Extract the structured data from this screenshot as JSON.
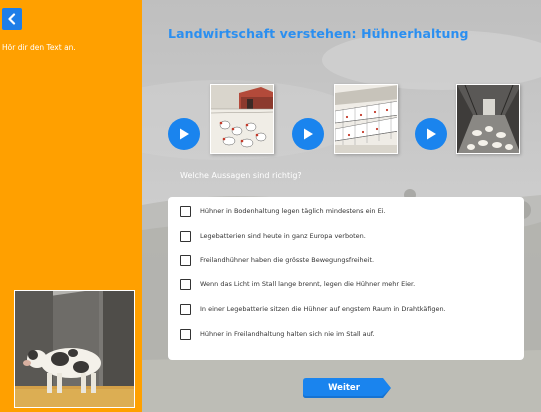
{
  "sidebar": {
    "back_icon": "chevron-left-icon",
    "hint": "Hör dir den Text an."
  },
  "title": "Landwirtschaft verstehen: Hühnerhaltung",
  "media": [
    {
      "play_icon": "play-icon",
      "thumbnail": "free-range-chickens"
    },
    {
      "play_icon": "play-icon",
      "thumbnail": "battery-cages"
    },
    {
      "play_icon": "play-icon",
      "thumbnail": "barn-floor-housing"
    }
  ],
  "question": "Welche Aussagen sind richtig?",
  "answers": [
    {
      "text": "Hühner in Bodenhaltung legen täglich mindestens ein Ei.",
      "checked": false
    },
    {
      "text": "Legebatterien sind heute in ganz Europa verboten.",
      "checked": false
    },
    {
      "text": "Freilandhühner haben die grösste Bewegungsfreiheit.",
      "checked": false
    },
    {
      "text": "Wenn das Licht im Stall lange brennt, legen die Hühner mehr Eier.",
      "checked": false
    },
    {
      "text": "In einer Legebatterie sitzen die Hühner auf engstem Raum in Drahtkäfigen.",
      "checked": false
    },
    {
      "text": "Hühner in Freilandhaltung halten sich nie im Stall auf.",
      "checked": false
    }
  ],
  "next_label": "Weiter",
  "colors": {
    "sidebar": "#ffa000",
    "accent": "#1a84ee",
    "title": "#2b8ff0"
  }
}
